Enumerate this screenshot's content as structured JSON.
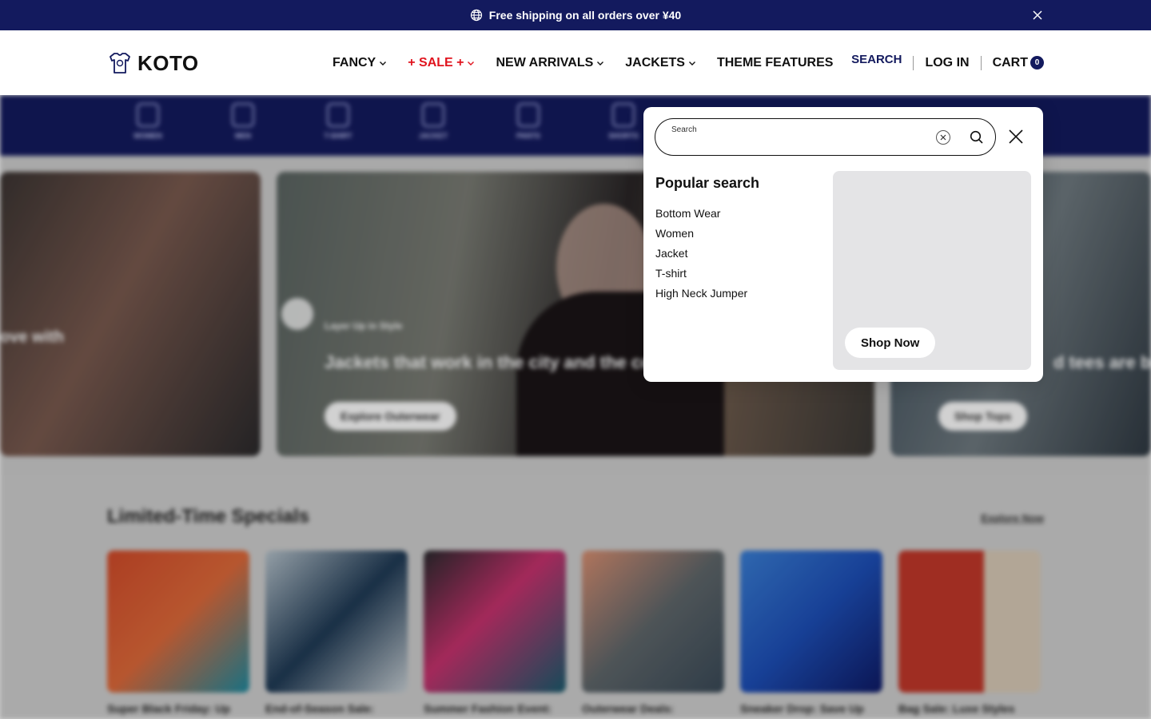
{
  "announcement": {
    "text": "Free shipping on all orders over ¥40",
    "icon": "globe-icon"
  },
  "header": {
    "logo_text": "KOTO",
    "nav": [
      {
        "label": "FANCY",
        "has_dropdown": true
      },
      {
        "label": "+ SALE +",
        "has_dropdown": true,
        "color": "#e0141e"
      },
      {
        "label": "NEW ARRIVALS",
        "has_dropdown": true
      },
      {
        "label": "JACKETS",
        "has_dropdown": true
      },
      {
        "label": "THEME FEATURES",
        "has_dropdown": false
      }
    ],
    "search_label": "SEARCH",
    "login_label": "LOG IN",
    "cart_label": "CART",
    "cart_count": "0"
  },
  "backdrop": {
    "categories": [
      "WOMEN",
      "MEN",
      "T-SHIRT",
      "JACKET",
      "PANTS",
      "SHORTS"
    ],
    "slides": [
      {
        "headline": "ove with"
      },
      {
        "eyebrow": "Layer Up in Style",
        "headline": "Jackets that work in the city and the co",
        "button": "Explore Outerwear"
      },
      {
        "headline": "d tees are ba",
        "button": "Shop Tops"
      }
    ],
    "specials_title": "Limited-Time Specials",
    "specials_link": "Explore Now",
    "specials": [
      "Super Black Friday: Up",
      "End-of-Season Sale:",
      "Summer Fashion Event:",
      "Outerwear Deals:",
      "Sneaker Drop: Save Up",
      "Bag Sale: Luxe Styles"
    ]
  },
  "search_panel": {
    "field_label": "Search",
    "field_value": "",
    "popular_title": "Popular search",
    "popular_items": [
      "Bottom Wear",
      "Women",
      "Jacket",
      "T-shirt",
      "High Neck Jumper"
    ],
    "promo_button": "Shop Now"
  },
  "colors": {
    "brand_navy": "#131a5e",
    "sale_red": "#e0141e"
  }
}
